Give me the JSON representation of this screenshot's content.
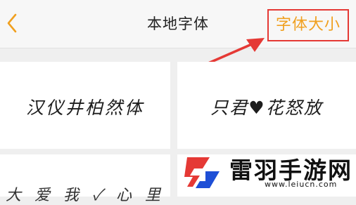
{
  "header": {
    "title": "本地字体",
    "back_icon": "chevron-left-icon",
    "font_size_button": "字体大小"
  },
  "fonts": [
    {
      "sample": "汉仪井柏然体"
    },
    {
      "sample": "只君♥花怒放"
    },
    {
      "sample": "大 爱 我 ✓ 心 里"
    }
  ],
  "watermark": {
    "text": "雷羽手游网",
    "url": "www.leiucn.com"
  },
  "colors": {
    "accent": "#f0a020",
    "highlight": "#e53935",
    "logo_red": "#e53935",
    "logo_blue": "#1e4fd6"
  }
}
